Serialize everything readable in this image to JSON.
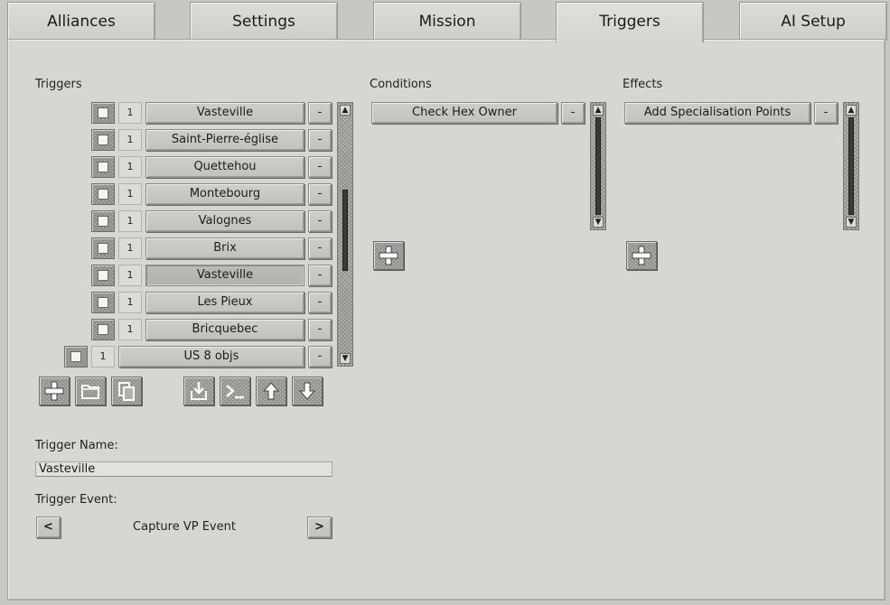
{
  "tabs": [
    {
      "label": "Alliances"
    },
    {
      "label": "Settings"
    },
    {
      "label": "Mission"
    },
    {
      "label": "Triggers",
      "active": true
    },
    {
      "label": "AI Setup"
    }
  ],
  "triggers_section": {
    "heading": "Triggers",
    "items": [
      {
        "count": "1",
        "name": "Vasteville"
      },
      {
        "count": "1",
        "name": "Saint-Pierre-église"
      },
      {
        "count": "1",
        "name": "Quettehou"
      },
      {
        "count": "1",
        "name": "Montebourg"
      },
      {
        "count": "1",
        "name": "Valognes"
      },
      {
        "count": "1",
        "name": "Brix"
      },
      {
        "count": "1",
        "name": "Vasteville",
        "selected": true
      },
      {
        "count": "1",
        "name": "Les Pieux"
      },
      {
        "count": "1",
        "name": "Bricquebec"
      },
      {
        "count": "1",
        "name": "US 8 objs"
      }
    ],
    "remove_label": "-"
  },
  "conditions_section": {
    "heading": "Conditions",
    "items": [
      {
        "name": "Check Hex Owner"
      }
    ],
    "remove_label": "-"
  },
  "effects_section": {
    "heading": "Effects",
    "items": [
      {
        "name": "Add Specialisation Points"
      }
    ],
    "remove_label": "-"
  },
  "trigger_name": {
    "label": "Trigger Name:",
    "value": "Vasteville"
  },
  "trigger_event": {
    "label": "Trigger Event:",
    "value": "Capture VP Event",
    "prev_label": "<",
    "next_label": ">"
  },
  "icons": {
    "add": "plus-icon",
    "folder": "folder-icon",
    "copy": "copy-icon",
    "import": "import-icon",
    "console": "console-icon",
    "up": "arrow-up-icon",
    "down": "arrow-down-icon"
  },
  "colors": {
    "background": "#c8c7c4",
    "panel": "#d7d6d3",
    "button": "#c8c7c4",
    "scroll_track": "#3a3a38"
  }
}
